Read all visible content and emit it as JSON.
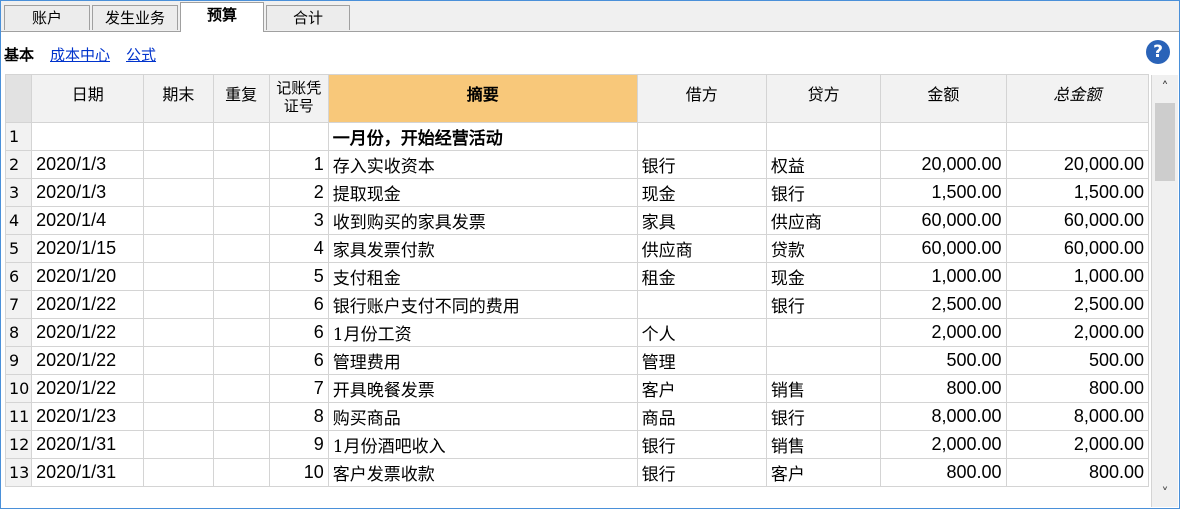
{
  "tabs": [
    {
      "label": "账户",
      "active": false
    },
    {
      "label": "发生业务",
      "active": false
    },
    {
      "label": "预算",
      "active": true
    },
    {
      "label": "合计",
      "active": false
    }
  ],
  "subview": {
    "current": "基本",
    "links": [
      "成本中心",
      "公式"
    ],
    "help_label": "?"
  },
  "columns": {
    "date": "日期",
    "period_end": "期末",
    "repeat": "重复",
    "voucher": [
      "记账凭",
      "证号"
    ],
    "description": "摘要",
    "debit": "借方",
    "credit": "贷方",
    "amount": "金额",
    "total_amount": "总金额"
  },
  "rows": [
    {
      "n": "1",
      "date": "",
      "end": "",
      "rep": "",
      "doc": "",
      "desc": "一月份，开始经营活动",
      "debit": "",
      "credit": "",
      "amount": "",
      "total": "",
      "bold": true
    },
    {
      "n": "2",
      "date": "2020/1/3",
      "end": "",
      "rep": "",
      "doc": "1",
      "desc": "存入实收资本",
      "debit": "银行",
      "credit": "权益",
      "amount": "20,000.00",
      "total": "20,000.00"
    },
    {
      "n": "3",
      "date": "2020/1/3",
      "end": "",
      "rep": "",
      "doc": "2",
      "desc": "提取现金",
      "debit": "现金",
      "credit": "银行",
      "amount": "1,500.00",
      "total": "1,500.00"
    },
    {
      "n": "4",
      "date": "2020/1/4",
      "end": "",
      "rep": "",
      "doc": "3",
      "desc": "收到购买的家具发票",
      "debit": "家具",
      "credit": "供应商",
      "amount": "60,000.00",
      "total": "60,000.00"
    },
    {
      "n": "5",
      "date": "2020/1/15",
      "end": "",
      "rep": "",
      "doc": "4",
      "desc": "家具发票付款",
      "debit": "供应商",
      "credit": "贷款",
      "amount": "60,000.00",
      "total": "60,000.00"
    },
    {
      "n": "6",
      "date": "2020/1/20",
      "end": "",
      "rep": "",
      "doc": "5",
      "desc": "支付租金",
      "debit": "租金",
      "credit": "现金",
      "amount": "1,000.00",
      "total": "1,000.00"
    },
    {
      "n": "7",
      "date": "2020/1/22",
      "end": "",
      "rep": "",
      "doc": "6",
      "desc": "银行账户支付不同的费用",
      "debit": "",
      "credit": "银行",
      "amount": "2,500.00",
      "total": "2,500.00"
    },
    {
      "n": "8",
      "date": "2020/1/22",
      "end": "",
      "rep": "",
      "doc": "6",
      "desc": "1月份工资",
      "debit": "个人",
      "credit": "",
      "amount": "2,000.00",
      "total": "2,000.00"
    },
    {
      "n": "9",
      "date": "2020/1/22",
      "end": "",
      "rep": "",
      "doc": "6",
      "desc": "管理费用",
      "debit": "管理",
      "credit": "",
      "amount": "500.00",
      "total": "500.00"
    },
    {
      "n": "10",
      "date": "2020/1/22",
      "end": "",
      "rep": "",
      "doc": "7",
      "desc": "开具晚餐发票",
      "debit": "客户",
      "credit": "销售",
      "amount": "800.00",
      "total": "800.00"
    },
    {
      "n": "11",
      "date": "2020/1/23",
      "end": "",
      "rep": "",
      "doc": "8",
      "desc": "购买商品",
      "debit": "商品",
      "credit": "银行",
      "amount": "8,000.00",
      "total": "8,000.00"
    },
    {
      "n": "12",
      "date": "2020/1/31",
      "end": "",
      "rep": "",
      "doc": "9",
      "desc": "1月份酒吧收入",
      "debit": "银行",
      "credit": "销售",
      "amount": "2,000.00",
      "total": "2,000.00"
    },
    {
      "n": "13",
      "date": "2020/1/31",
      "end": "",
      "rep": "",
      "doc": "10",
      "desc": "客户发票收款",
      "debit": "银行",
      "credit": "客户",
      "amount": "800.00",
      "total": "800.00"
    }
  ],
  "scrollbar": {
    "up_icon": "chevron-up-icon",
    "down_icon": "chevron-down-icon"
  },
  "colors": {
    "selected_header": "#f8c87a",
    "link": "#0033cc",
    "help": "#2a63b8",
    "window_border": "#4a90d9"
  }
}
